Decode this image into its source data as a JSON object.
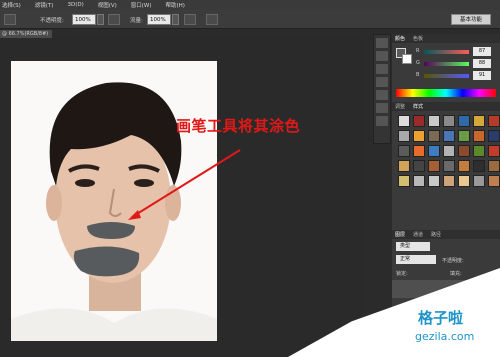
{
  "menubar": {
    "items": [
      "选择(S)",
      "滤镜(T)",
      "3D(D)",
      "视图(V)",
      "窗口(W)",
      "帮助(H)"
    ]
  },
  "options": {
    "opacity_label": "不透明度:",
    "opacity_value": "100%",
    "flow_label": "流量:",
    "flow_value": "100%"
  },
  "workspace_button": "基本功能",
  "doc_tab": "@ 66.7%(RGB/8#) ×",
  "color_panel": {
    "tabs": [
      "颜色",
      "色板"
    ],
    "channels": [
      {
        "name": "R",
        "value": "87"
      },
      {
        "name": "G",
        "value": "88"
      },
      {
        "name": "B",
        "value": "91"
      }
    ]
  },
  "swatch_panel": {
    "tabs": [
      "调整",
      "样式"
    ]
  },
  "layers_panel": {
    "tabs": [
      "图层",
      "通道",
      "路径"
    ],
    "kind_label": "类型",
    "mode_label": "正常",
    "opacity_label": "不透明度:",
    "lock_label": "锁定:",
    "fill_label": "填充:"
  },
  "annotation_text": "画笔工具将其涂色",
  "watermark": {
    "title": "格子啦",
    "url": "gezila.com"
  },
  "colors": {
    "annotation": "#e01818",
    "paint_gray": "#575b5e",
    "watermark": "#1d93c8"
  }
}
